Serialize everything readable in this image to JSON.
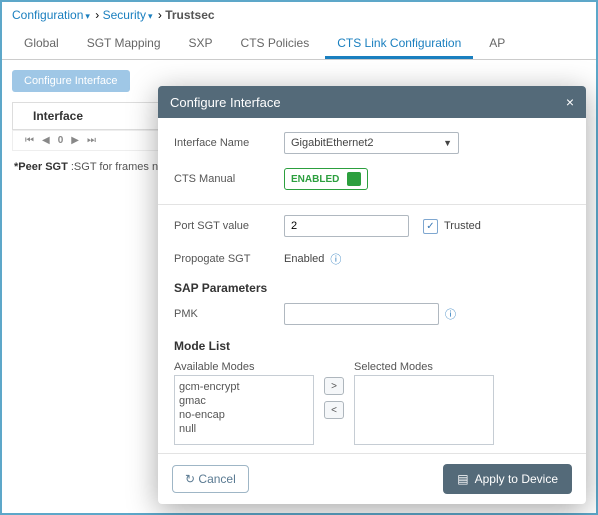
{
  "breadcrumb": {
    "a": "Configuration",
    "b": "Security",
    "c": "Trustsec"
  },
  "tabs": {
    "t0": "Global",
    "t1": "SGT Mapping",
    "t2": "SXP",
    "t3": "CTS Policies",
    "t4": "CTS Link Configuration",
    "t5": "AP"
  },
  "toolbar": {
    "configure": "Configure Interface"
  },
  "table": {
    "hdr": "Interface",
    "page": "0"
  },
  "note_b": "*Peer SGT",
  "note_t": " :SGT for frames not",
  "modal": {
    "title": "Configure Interface",
    "close": "×",
    "iface_lbl": "Interface Name",
    "iface_val": "GigabitEthernet2",
    "cts_lbl": "CTS Manual",
    "cts_val": "ENABLED",
    "port_lbl": "Port SGT value",
    "port_val": "2",
    "trusted": "Trusted",
    "prop_lbl": "Propogate SGT",
    "prop_val": "Enabled",
    "sap": "SAP Parameters",
    "pmk": "PMK",
    "mode_hdr": "Mode List",
    "avail_lbl": "Available Modes",
    "sel_lbl": "Selected Modes",
    "modes": {
      "m0": "gcm-encrypt",
      "m1": "gmac",
      "m2": "no-encap",
      "m3": "null"
    },
    "move_r": ">",
    "move_l": "<",
    "cancel": "Cancel",
    "apply": "Apply to Device"
  }
}
